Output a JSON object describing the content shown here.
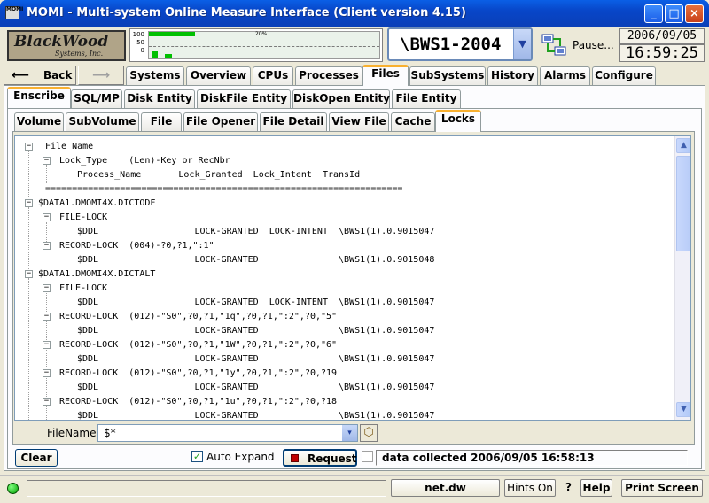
{
  "window": {
    "title": "MOMI - Multi-system Online Measure Interface (Client version 4.15)",
    "app_icon_text": "MOMI",
    "min_glyph": "_",
    "max_glyph": "□",
    "close_glyph": "×"
  },
  "header": {
    "logo_line1": "BlackWood",
    "logo_line2": "Systems, Inc.",
    "gauge_scale": [
      "100",
      "50",
      "0"
    ],
    "gauge_mid_label": "20%",
    "gauge_level_percent": 20,
    "system_name": "\\BWS1-2004",
    "pause_label": "Pause...",
    "date": "2006/09/05",
    "time": "16:59:25"
  },
  "nav": {
    "back_label": "Back",
    "back_glyph": "⟵",
    "forward_glyph": "⟶",
    "tabs": [
      "Systems",
      "Overview",
      "CPUs",
      "Processes",
      "Files",
      "SubSystems",
      "History",
      "Alarms",
      "Configure"
    ],
    "selected": "Files"
  },
  "subtabs": {
    "items": [
      "Enscribe",
      "SQL/MP",
      "Disk Entity",
      "DiskFile Entity",
      "DiskOpen Entity",
      "File Entity"
    ],
    "selected": "Enscribe"
  },
  "subtabs2": {
    "items": [
      "Volume",
      "SubVolume",
      "File",
      "File Opener",
      "File Detail",
      "View File",
      "Cache",
      "Locks"
    ],
    "selected": "Locks"
  },
  "tree": {
    "header": [
      "File_Name",
      "Lock_Type    (Len)-Key or RecNbr",
      "Process_Name       Lock_Granted  Lock_Intent  TransId",
      "==================================================================="
    ],
    "rows": [
      "$DATA1.DMOMI4X.DICTODF",
      "FILE-LOCK",
      "$DDL                  LOCK-GRANTED  LOCK-INTENT  \\BWS1(1).0.9015047",
      "RECORD-LOCK  (004)-?0,?1,\":1\"",
      "$DDL                  LOCK-GRANTED               \\BWS1(1).0.9015048",
      "$DATA1.DMOMI4X.DICTALT",
      "FILE-LOCK",
      "$DDL                  LOCK-GRANTED  LOCK-INTENT  \\BWS1(1).0.9015047",
      "RECORD-LOCK  (012)-\"S0\",?0,?1,\"1q\",?0,?1,\":2\",?0,\"5\"",
      "$DDL                  LOCK-GRANTED               \\BWS1(1).0.9015047",
      "RECORD-LOCK  (012)-\"S0\",?0,?1,\"1W\",?0,?1,\":2\",?0,\"6\"",
      "$DDL                  LOCK-GRANTED               \\BWS1(1).0.9015047",
      "RECORD-LOCK  (012)-\"S0\",?0,?1,\"1y\",?0,?1,\":2\",?0,?19",
      "$DDL                  LOCK-GRANTED               \\BWS1(1).0.9015047",
      "RECORD-LOCK  (012)-\"S0\",?0,?1,\"1u\",?0,?1,\":2\",?0,?18",
      "$DDL                  LOCK-GRANTED               \\BWS1(1).0.9015047"
    ],
    "expand_glyph": "−"
  },
  "filter": {
    "label": "FileName",
    "value": "$*",
    "dropdown_glyph": "▾"
  },
  "controls": {
    "clear_label": "Clear",
    "auto_expand_label": "Auto Expand",
    "auto_expand_checked": true,
    "check_glyph": "✓",
    "request_label": "Request",
    "status_text": "data collected 2006/09/05 16:58:13"
  },
  "footer": {
    "server": "net.dw",
    "hints_label": "Hints On",
    "question_glyph": "?",
    "help_label": "Help",
    "print_label": "Print Screen"
  },
  "colors": {
    "title_blue": "#0846c8",
    "tab_highlight": "#f8b030",
    "gauge_green": "#00c000",
    "request_red": "#c00000"
  }
}
